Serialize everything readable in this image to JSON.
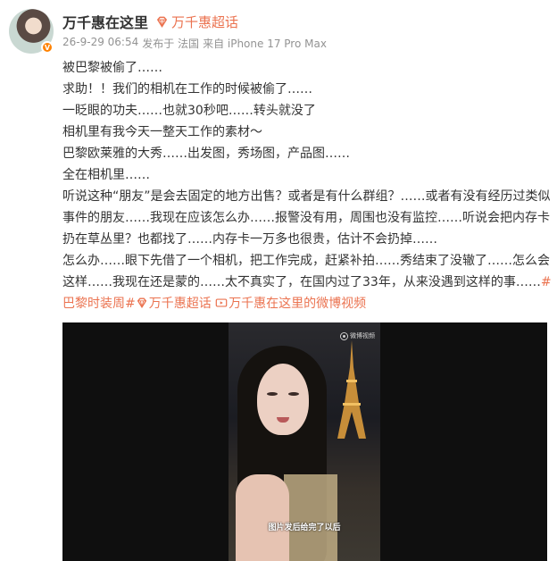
{
  "author": {
    "name": "万千惠在这里",
    "super_topic_label": "万千惠超话",
    "verified_badge": "V"
  },
  "meta": {
    "timestamp": "26-9-29 06:54",
    "source": "发布于 法国",
    "device": "来自 iPhone 17 Pro Max"
  },
  "post": {
    "paragraphs": [
      "被巴黎被偷了……",
      "求助！！我们的相机在工作的时候被偷了……",
      "一眨眼的功夫……也就30秒吧……转头就没了",
      "相机里有我今天一整天工作的素材～",
      "巴黎欧莱雅的大秀……出发图，秀场图，产品图……",
      "全在相机里……",
      "听说这种“朋友”是会去固定的地方出售？或者是有什么群组？……或者有没有经历过类似事件的朋友……我现在应该怎么办……报警没有用，周围也没有监控……听说会把内存卡扔在草丛里？也都找了……内存卡一万多也很贵，估计不会扔掉……",
      "怎么办……眼下先借了一个相机，把工作完成，赶紧补拍……秀结束了没辙了……怎么会这样……我现在还是蒙的……太不真实了，在国内过了33年，从来没遇到这样的事……"
    ],
    "hashtag": "#巴黎时装周#",
    "topic_link": "万千惠超话",
    "video_link": "万千惠在这里的微博视频"
  },
  "video": {
    "watermark": "微博视频",
    "subtitle": "图片发后给完了以后"
  },
  "colors": {
    "accent": "#eb7350",
    "meta_gray": "#939393",
    "text": "#333333"
  },
  "icons": {
    "super_topic": "diamond-icon",
    "video": "video-icon",
    "verified": "verified-badge-icon"
  }
}
